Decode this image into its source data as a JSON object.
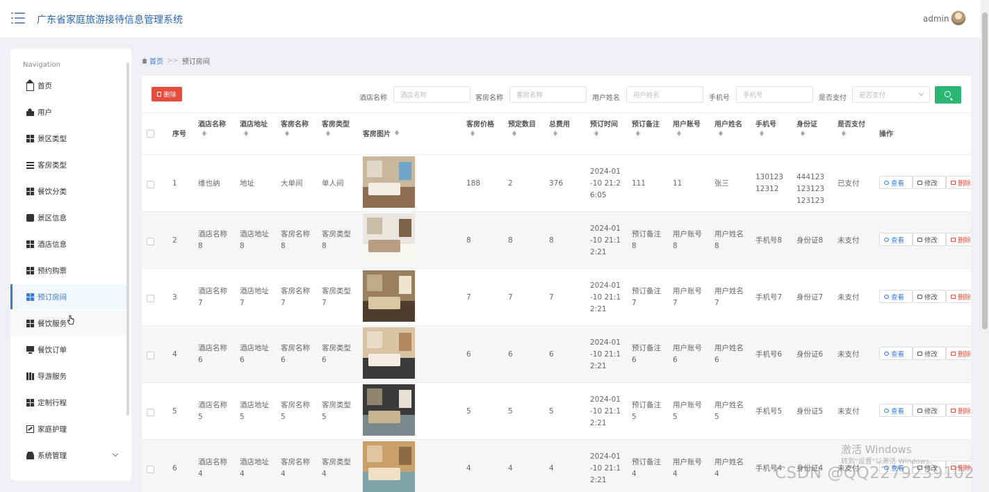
{
  "header": {
    "title": "广东省家庭旅游接待信息管理系统",
    "user": "admin"
  },
  "sidebar": {
    "heading": "Navigation",
    "items": [
      {
        "label": "首页",
        "icon": "home-icon"
      },
      {
        "label": "用户",
        "icon": "user-icon"
      },
      {
        "label": "景区类型",
        "icon": "grid-icon"
      },
      {
        "label": "客房类型",
        "icon": "list-icon"
      },
      {
        "label": "餐饮分类",
        "icon": "grid-icon"
      },
      {
        "label": "景区信息",
        "icon": "chat-icon"
      },
      {
        "label": "酒店信息",
        "icon": "grid-icon"
      },
      {
        "label": "预约购票",
        "icon": "grid-icon"
      },
      {
        "label": "预订房间",
        "icon": "grid-icon"
      },
      {
        "label": "餐饮服务",
        "icon": "grid-icon"
      },
      {
        "label": "餐饮订单",
        "icon": "monitor-icon"
      },
      {
        "label": "导游服务",
        "icon": "book-icon"
      },
      {
        "label": "定制行程",
        "icon": "grid-icon"
      },
      {
        "label": "家庭护理",
        "icon": "chart-icon"
      },
      {
        "label": "系统管理",
        "icon": "person-icon"
      }
    ]
  },
  "breadcrumb": {
    "home": "首页",
    "sep": ">>",
    "current": "预订房间"
  },
  "toolbar": {
    "delete_label": "删除"
  },
  "filters": [
    {
      "label": "酒店名称",
      "placeholder": "酒店名称"
    },
    {
      "label": "客房名称",
      "placeholder": "客房名称"
    },
    {
      "label": "用户姓名",
      "placeholder": "用户姓名"
    },
    {
      "label": "手机号",
      "placeholder": "手机号"
    },
    {
      "label": "是否支付",
      "placeholder": "是否支付"
    }
  ],
  "table": {
    "headers": {
      "index": "序号",
      "hotel": "酒店名称",
      "address": "酒店地址",
      "room": "客房名称",
      "roomtype": "客房类型",
      "photo": "客房图片",
      "price": "客房价格",
      "qty": "预定数目",
      "total": "总费用",
      "time": "预订时间",
      "note": "预订备注",
      "account": "用户账号",
      "username": "用户姓名",
      "phone": "手机号",
      "idcard": "身份证",
      "paid": "是否支付",
      "actions": "操作"
    },
    "action_labels": {
      "view": "查看",
      "edit": "修改",
      "del": "删除"
    },
    "rows": [
      {
        "index": "1",
        "hotel": "维也纳",
        "address": "地址",
        "room": "大单间",
        "roomtype": "单人间",
        "price": "188",
        "qty": "2",
        "total": "376",
        "time": "2024-01-10 21:26:05",
        "note": "111",
        "account": "11",
        "username": "张三",
        "phone": "13012312312",
        "idcard": "444123123123123123",
        "paid": "已支付"
      },
      {
        "index": "2",
        "hotel": "酒店名称8",
        "address": "酒店地址8",
        "room": "客房名称8",
        "roomtype": "客房类型8",
        "price": "8",
        "qty": "8",
        "total": "8",
        "time": "2024-01-10 21:12:21",
        "note": "预订备注8",
        "account": "用户账号8",
        "username": "用户姓名8",
        "phone": "手机号8",
        "idcard": "身份证8",
        "paid": "未支付"
      },
      {
        "index": "3",
        "hotel": "酒店名称7",
        "address": "酒店地址7",
        "room": "客房名称7",
        "roomtype": "客房类型7",
        "price": "7",
        "qty": "7",
        "total": "7",
        "time": "2024-01-10 21:12:21",
        "note": "预订备注7",
        "account": "用户账号7",
        "username": "用户姓名7",
        "phone": "手机号7",
        "idcard": "身份证7",
        "paid": "未支付"
      },
      {
        "index": "4",
        "hotel": "酒店名称6",
        "address": "酒店地址6",
        "room": "客房名称6",
        "roomtype": "客房类型6",
        "price": "6",
        "qty": "6",
        "total": "6",
        "time": "2024-01-10 21:12:21",
        "note": "预订备注6",
        "account": "用户账号6",
        "username": "用户姓名6",
        "phone": "手机号6",
        "idcard": "身份证6",
        "paid": "未支付"
      },
      {
        "index": "5",
        "hotel": "酒店名称5",
        "address": "酒店地址5",
        "room": "客房名称5",
        "roomtype": "客房类型5",
        "price": "5",
        "qty": "5",
        "total": "5",
        "time": "2024-01-10 21:12:21",
        "note": "预订备注5",
        "account": "用户账号5",
        "username": "用户姓名5",
        "phone": "手机号5",
        "idcard": "身份证5",
        "paid": "未支付"
      },
      {
        "index": "6",
        "hotel": "酒店名称4",
        "address": "酒店地址4",
        "room": "客房名称4",
        "roomtype": "客房类型4",
        "price": "4",
        "qty": "4",
        "total": "4",
        "time": "2024-01-10 21:12:21",
        "note": "预订备注4",
        "account": "用户账号4",
        "username": "用户姓名4",
        "phone": "手机号4",
        "idcard": "身份证4",
        "paid": "未支付"
      }
    ]
  },
  "overlay": {
    "activation_title": "激活 Windows",
    "activation_sub": "转到\"设置\"以激活 Windows。",
    "watermark": "CSDN @QQ2279239102"
  },
  "colors": {
    "accent": "#3a7bd5",
    "danger": "#e74c3c",
    "success": "#2bb673"
  }
}
